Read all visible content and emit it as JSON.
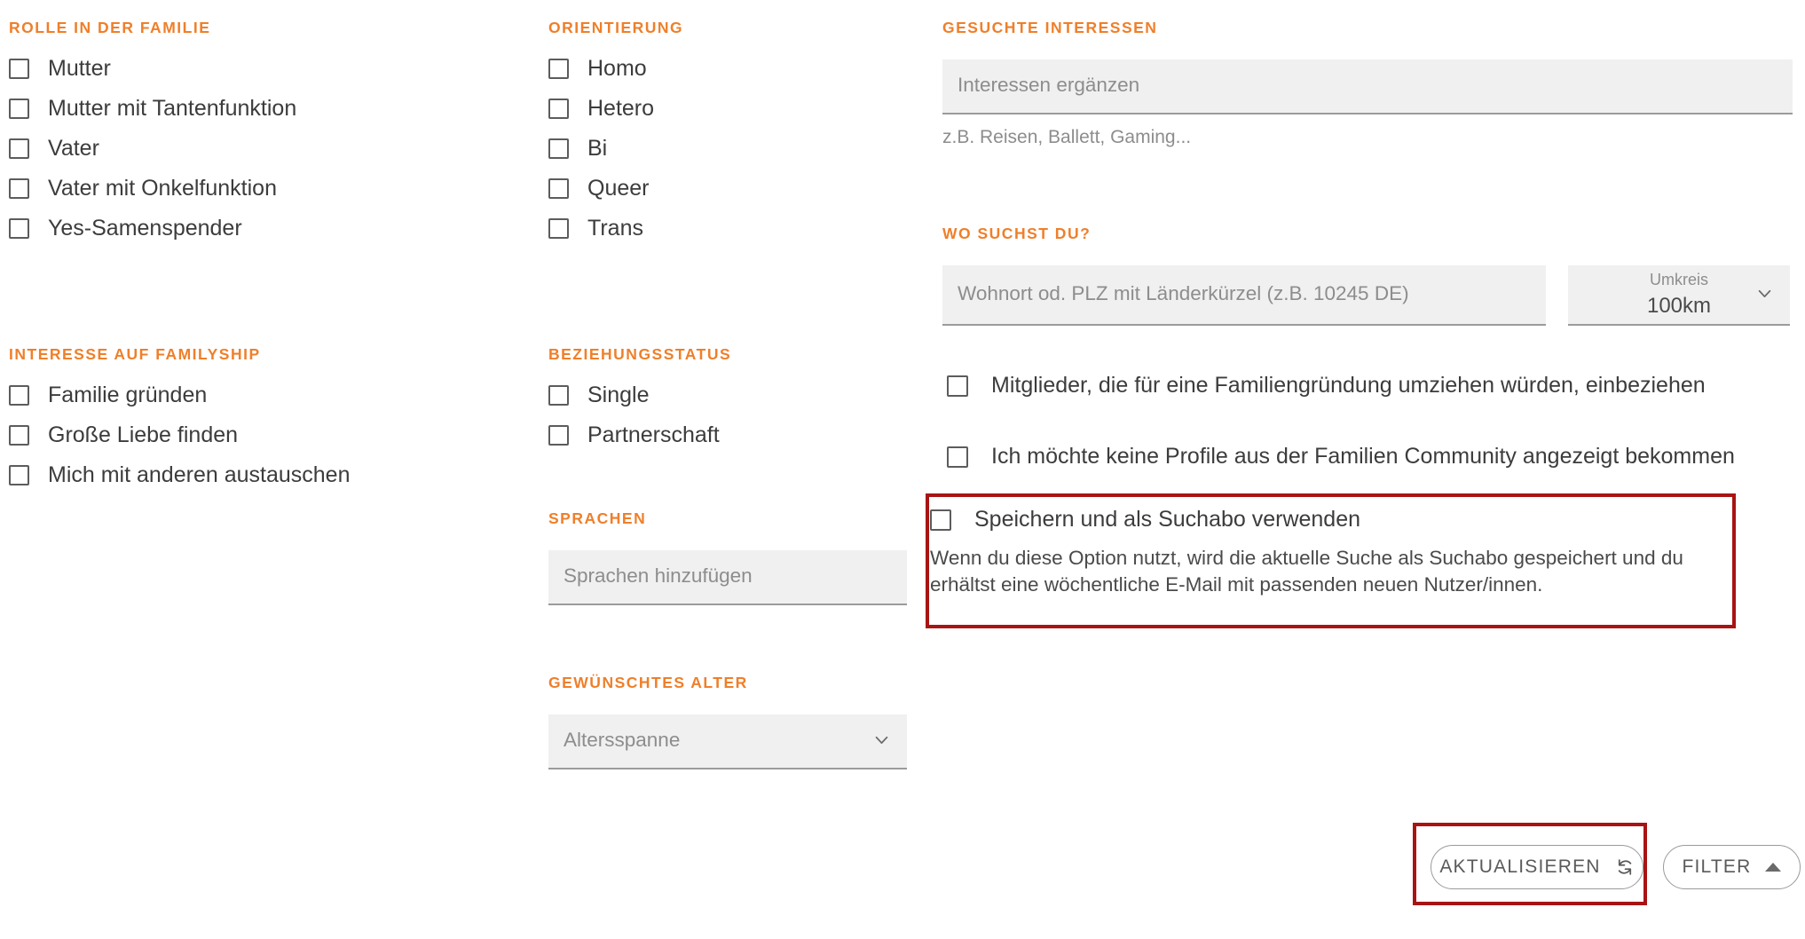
{
  "theme": {
    "accent_orange": "#EF7F2A",
    "highlight_red": "#A81414",
    "text_dark": "#3C3C3C",
    "field_bg": "#F0F0F0",
    "placeholder_gray": "#8D8D8D"
  },
  "column_left": {
    "group_role": {
      "title": "ROLLE IN DER FAMILIE",
      "options": [
        {
          "label": "Mutter",
          "checked": false
        },
        {
          "label": "Mutter mit Tantenfunktion",
          "checked": false
        },
        {
          "label": "Vater",
          "checked": false
        },
        {
          "label": "Vater mit Onkelfunktion",
          "checked": false
        },
        {
          "label": "Yes-Samenspender",
          "checked": false
        }
      ]
    },
    "group_interest": {
      "title": "INTERESSE AUF FAMILYSHIP",
      "options": [
        {
          "label": "Familie gründen",
          "checked": false
        },
        {
          "label": "Große Liebe finden",
          "checked": false
        },
        {
          "label": "Mich mit anderen austauschen",
          "checked": false
        }
      ]
    }
  },
  "column_middle": {
    "group_orientation": {
      "title": "ORIENTIERUNG",
      "options": [
        {
          "label": "Homo",
          "checked": false
        },
        {
          "label": "Hetero",
          "checked": false
        },
        {
          "label": "Bi",
          "checked": false
        },
        {
          "label": "Queer",
          "checked": false
        },
        {
          "label": "Trans",
          "checked": false
        }
      ]
    },
    "group_relationship": {
      "title": "BEZIEHUNGSSTATUS",
      "options": [
        {
          "label": "Single",
          "checked": false
        },
        {
          "label": "Partnerschaft",
          "checked": false
        }
      ]
    },
    "group_languages": {
      "title": "SPRACHEN",
      "input_placeholder": "Sprachen hinzufügen",
      "input_value": ""
    },
    "group_age": {
      "title": "GEWÜNSCHTES ALTER",
      "select_value": "Altersspanne",
      "chevron_icon": "chevron-down-icon"
    }
  },
  "column_right": {
    "group_interests": {
      "title": "GESUCHTE INTERESSEN",
      "input_placeholder": "Interessen ergänzen",
      "input_value": "",
      "hint": "z.B. Reisen, Ballett, Gaming..."
    },
    "group_location": {
      "title": "WO SUCHST DU?",
      "input_placeholder": "Wohnort od. PLZ mit Länderkürzel (z.B. 10245 DE)",
      "input_value": "",
      "radius_label": "Umkreis",
      "radius_value": "100km",
      "chevron_icon": "chevron-down-icon"
    },
    "options": [
      {
        "label": "Mitglieder, die für eine Familiengründung umziehen würden, einbeziehen",
        "checked": false
      },
      {
        "label": "Ich möchte keine Profile aus der Familien Community angezeigt bekommen",
        "checked": false
      }
    ],
    "saved_search": {
      "checkbox_label": "Speichern und als Suchabo verwenden",
      "checked": false,
      "description": "Wenn du diese Option nutzt, wird die aktuelle Suche als Suchabo gespeichert und du erhältst eine wöchentliche E-Mail mit passenden neuen Nutzer/innen."
    }
  },
  "footer": {
    "update_button": {
      "label": "AKTUALISIEREN",
      "icon": "refresh-icon"
    },
    "filter_button": {
      "label": "FILTER",
      "icon": "caret-up-icon"
    }
  }
}
